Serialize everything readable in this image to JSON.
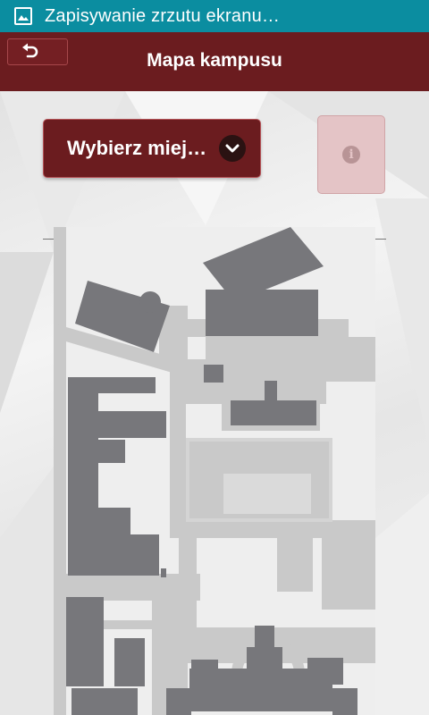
{
  "status_bar": {
    "notification_icon": "image-icon",
    "text": "Zapisywanie zrzutu ekranu…"
  },
  "app_bar": {
    "back_icon": "back-arrow-icon",
    "title": "Mapa kampusu"
  },
  "place_selector": {
    "value": "Wybierz miej…",
    "icon": "chevron-down-icon"
  },
  "info_button": {
    "icon": "info-icon",
    "state": "disabled"
  },
  "colors": {
    "status_bar": "#0b8da0",
    "app_bar": "#6b1c1f",
    "buildings": "#77777b",
    "paths": "#c9c9c9"
  }
}
